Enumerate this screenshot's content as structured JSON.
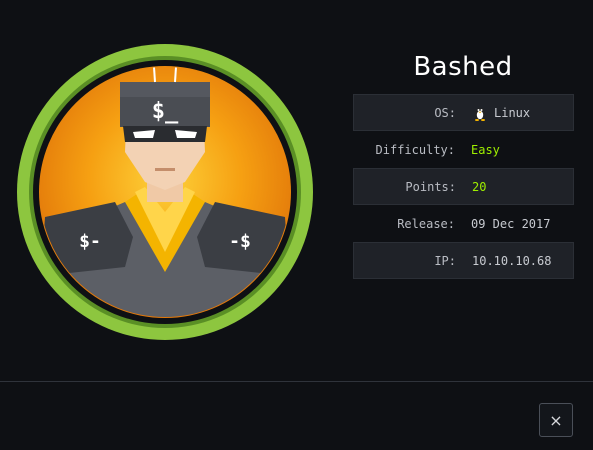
{
  "machine": {
    "name": "Bashed",
    "avatar_icon": "shell-superhero-avatar"
  },
  "info": {
    "os_label": "OS:",
    "os_value": "Linux",
    "os_icon": "linux-tux-icon",
    "difficulty_label": "Difficulty:",
    "difficulty_value": "Easy",
    "points_label": "Points:",
    "points_value": "20",
    "release_label": "Release:",
    "release_value": "09 Dec 2017",
    "ip_label": "IP:",
    "ip_value": "10.10.10.68"
  },
  "footer": {
    "close_label": "×"
  },
  "colors": {
    "background": "#0e1014",
    "accent_green": "#9fef00",
    "ring_green": "#8dc63f",
    "avatar_orange": "#f6a012"
  }
}
